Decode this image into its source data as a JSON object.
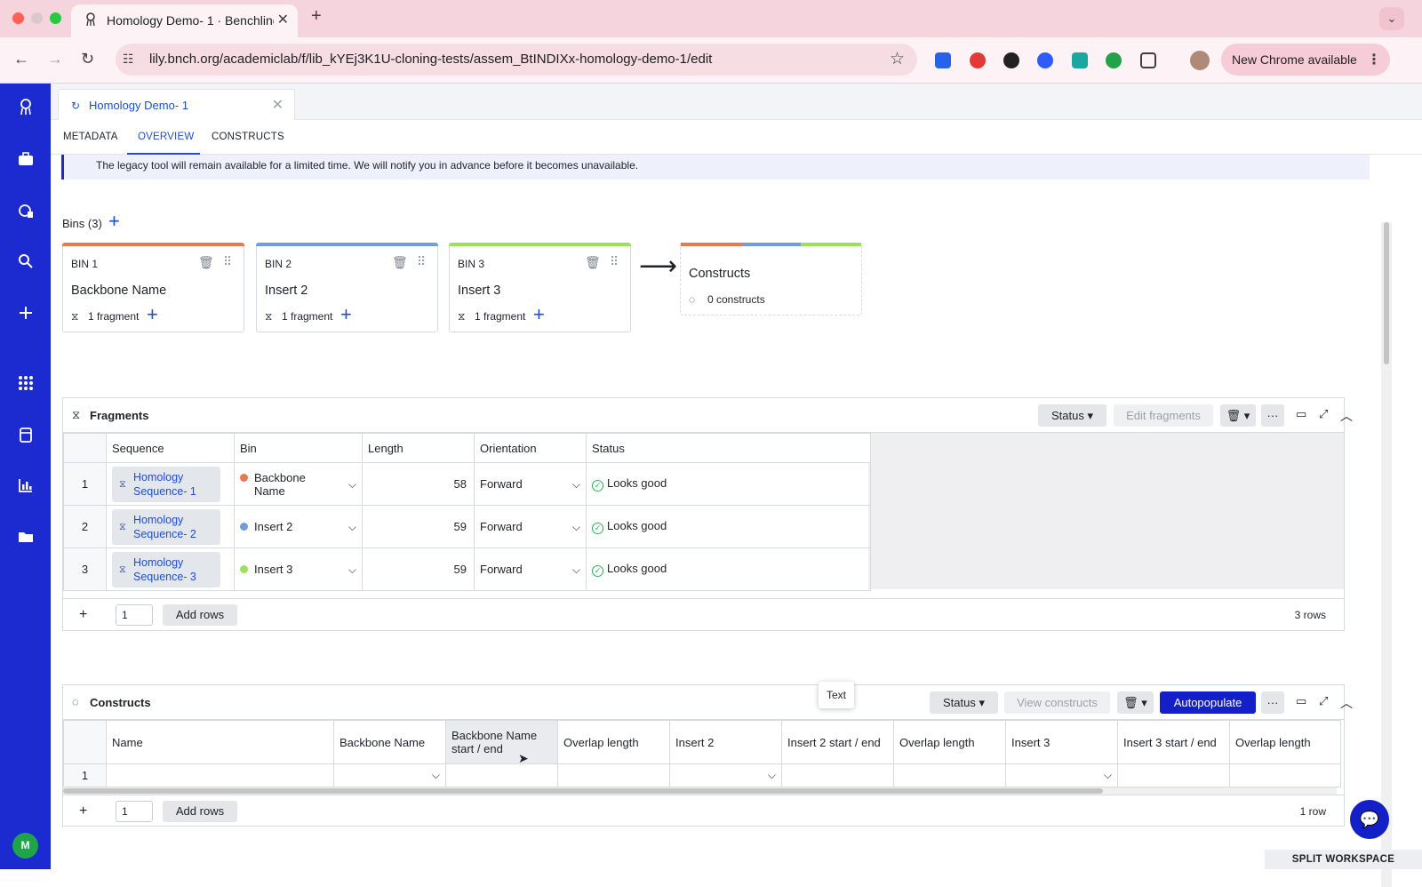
{
  "browser": {
    "tab_title": "Homology Demo- 1 · Benchling",
    "url": "lily.bnch.org/academiclab/f/lib_kYEj3K1U-cloning-tests/assem_BtINDIXx-homology-demo-1/edit",
    "new_chrome_label": "New Chrome available"
  },
  "app": {
    "avatar_initial": "M",
    "colors": {
      "sidebar": "#1b2bd0",
      "accent": "#1d4ed8",
      "primary_button": "#1420c7"
    }
  },
  "document": {
    "tab_label": "Homology Demo- 1",
    "subtabs": [
      "METADATA",
      "OVERVIEW",
      "CONSTRUCTS"
    ],
    "active_subtab": "OVERVIEW",
    "banner_text": "The legacy tool will remain available for a limited time. We will notify you in advance before it becomes unavailable."
  },
  "bins": {
    "title": "Bins (3)",
    "items": [
      {
        "id": "BIN 1",
        "name": "Backbone Name",
        "fragments": "1 fragment",
        "color": "#e8784e"
      },
      {
        "id": "BIN 2",
        "name": "Insert 2",
        "fragments": "1 fragment",
        "color": "#6f9edb"
      },
      {
        "id": "BIN 3",
        "name": "Insert 3",
        "fragments": "1 fragment",
        "color": "#9be05a"
      }
    ],
    "constructs_card": {
      "title": "Constructs",
      "count": "0 constructs"
    }
  },
  "fragments": {
    "title": "Fragments",
    "buttons": {
      "status": "Status",
      "edit": "Edit fragments"
    },
    "columns": [
      "Sequence",
      "Bin",
      "Length",
      "Orientation",
      "Status"
    ],
    "rows": [
      {
        "index": "1",
        "sequence": "Homology Sequence- 1",
        "bin": "Backbone Name",
        "bin_color": "#e8784e",
        "length": "58",
        "orientation": "Forward",
        "status": "Looks good"
      },
      {
        "index": "2",
        "sequence": "Homology Sequence- 2",
        "bin": "Insert 2",
        "bin_color": "#6f9edb",
        "length": "59",
        "orientation": "Forward",
        "status": "Looks good"
      },
      {
        "index": "3",
        "sequence": "Homology Sequence- 3",
        "bin": "Insert 3",
        "bin_color": "#9be05a",
        "length": "59",
        "orientation": "Forward",
        "status": "Looks good"
      }
    ],
    "footer": {
      "add_count": "1",
      "add_rows_label": "Add rows",
      "row_count": "3 rows"
    }
  },
  "constructs": {
    "title": "Constructs",
    "buttons": {
      "status": "Status",
      "view": "View constructs",
      "autopopulate": "Autopopulate"
    },
    "tooltip": "Text",
    "columns": [
      "Name",
      "Backbone Name",
      "Backbone Name start / end",
      "Overlap length",
      "Insert 2",
      "Insert 2 start / end",
      "Overlap length",
      "Insert 3",
      "Insert 3 start / end",
      "Overlap length"
    ],
    "rows": [
      {
        "index": "1"
      }
    ],
    "footer": {
      "add_count": "1",
      "add_rows_label": "Add rows",
      "row_count": "1 row"
    }
  },
  "split_workspace_label": "SPLIT WORKSPACE"
}
